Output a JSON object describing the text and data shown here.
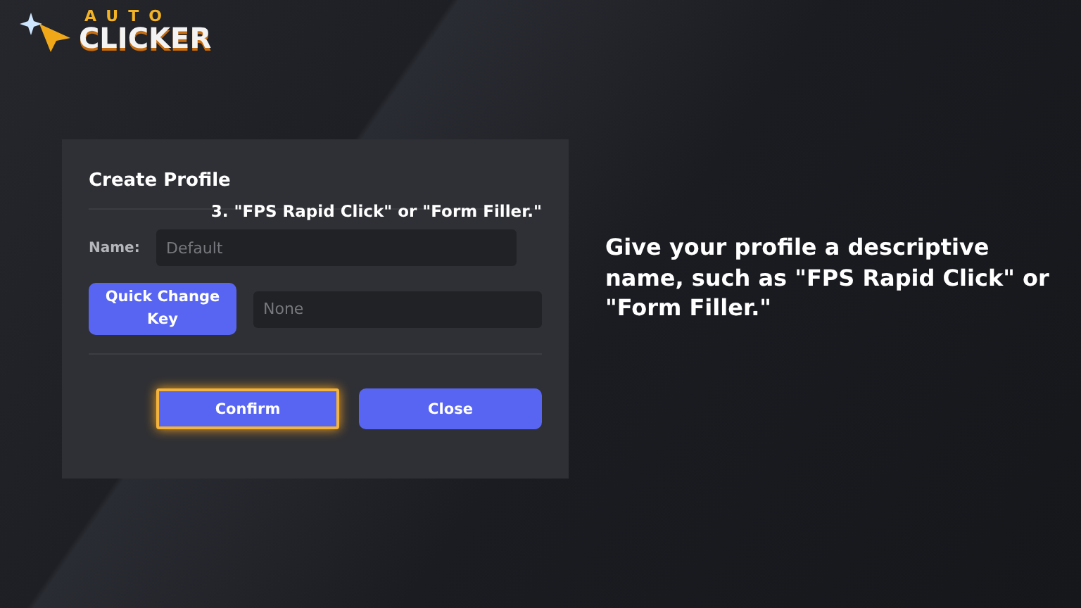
{
  "logo": {
    "line_1": "AUTO",
    "line_2": "CLICKER"
  },
  "dialog": {
    "title": "Create Profile",
    "step_caption": "3. \"FPS Rapid Click\" or \"Form Filler.\"",
    "name_field": {
      "label": "Name:",
      "placeholder": "Default"
    },
    "key_button": "Quick Change Key",
    "key_field": {
      "placeholder": "None"
    },
    "buttons": [
      {
        "label": "Confirm",
        "highlighted": true
      },
      {
        "label": "Close",
        "highlighted": false
      }
    ]
  },
  "instruction": "Give your profile a descriptive name, such as \"FPS Rapid Click\" or \"Form Filler.\""
}
